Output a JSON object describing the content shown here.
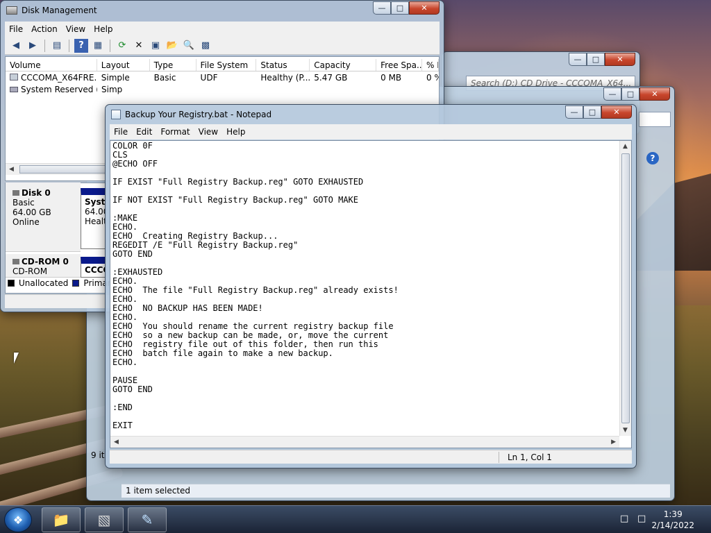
{
  "desktop": {},
  "disk_management": {
    "title": "Disk Management",
    "menu": [
      "File",
      "Action",
      "View",
      "Help"
    ],
    "columns": [
      "Volume",
      "Layout",
      "Type",
      "File System",
      "Status",
      "Capacity",
      "Free Spa...",
      "% F"
    ],
    "rows": [
      {
        "volume": "CCCOMA_X64FRE...",
        "layout": "Simple",
        "type": "Basic",
        "fs": "UDF",
        "status": "Healthy (P...",
        "capacity": "5.47 GB",
        "free": "0 MB",
        "pct": "0 %"
      },
      {
        "volume": "System Reserved (...",
        "layout": "Simp"
      }
    ],
    "disk0": {
      "name": "Disk 0",
      "type": "Basic",
      "size": "64.00 GB",
      "state": "Online",
      "part_name": "Syste",
      "part_size": "64.00",
      "part_status": "Healt"
    },
    "cdrom0": {
      "name": "CD-ROM 0",
      "type": "CD-ROM",
      "part_name": "CCCO"
    },
    "legend": {
      "unallocated": "Unallocated",
      "primary": "Primar"
    },
    "colors": {
      "unallocated": "#000000",
      "primary": "#0a1a8c"
    }
  },
  "explorer_back": {
    "search_placeholder": "Search (D:) CD Drive - CCCOMA_X64..."
  },
  "explorer_front": {
    "items_count_partial": "9 it",
    "status": "1 item selected",
    "help_icon": "help-icon"
  },
  "notepad": {
    "title": "Backup Your Registry.bat - Notepad",
    "menu": [
      "File",
      "Edit",
      "Format",
      "View",
      "Help"
    ],
    "content": "COLOR 0F\nCLS\n@ECHO OFF\n\nIF EXIST \"Full Registry Backup.reg\" GOTO EXHAUSTED\n\nIF NOT EXIST \"Full Registry Backup.reg\" GOTO MAKE\n\n:MAKE\nECHO.\nECHO  Creating Registry Backup...\nREGEDIT /E \"Full Registry Backup.reg\"\nGOTO END\n\n:EXHAUSTED\nECHO.\nECHO  The file \"Full Registry Backup.reg\" already exists!\nECHO.\nECHO  NO BACKUP HAS BEEN MADE!\nECHO.\nECHO  You should rename the current registry backup file\nECHO  so a new backup can be made, or, move the current\nECHO  registry file out of this folder, then run this\nECHO  batch file again to make a new backup.\nECHO.\n\nPAUSE\nGOTO END\n\n:END\n\nEXIT",
    "status_position": "Ln 1, Col 1"
  },
  "taskbar": {
    "time": "1:39",
    "date": "2/14/2022",
    "accent": "#1f5fb0"
  }
}
